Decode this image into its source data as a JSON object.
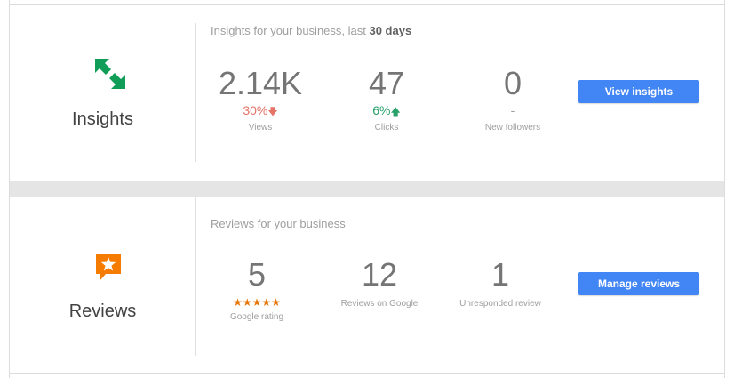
{
  "colors": {
    "accent": "#4285f4",
    "insights_icon": "#0f9d58",
    "reviews_icon": "#f57c00",
    "down": "#e57368",
    "up": "#27a06a"
  },
  "insights": {
    "icon": "arrows-exchange-icon",
    "label": "Insights",
    "caption_prefix": "Insights for your business, last ",
    "caption_bold": "30 days",
    "metrics": [
      {
        "value": "2.14K",
        "delta": "30%",
        "direction": "down",
        "arrow": "down-arrow-icon",
        "label": "Views"
      },
      {
        "value": "47",
        "delta": "6%",
        "direction": "up",
        "arrow": "up-arrow-icon",
        "label": "Clicks"
      },
      {
        "value": "0",
        "delta": "-",
        "direction": "none",
        "label": "New followers"
      }
    ],
    "button": "View insights"
  },
  "reviews": {
    "icon": "star-speech-bubble-icon",
    "label": "Reviews",
    "caption": "Reviews for your business",
    "metrics": [
      {
        "value": "5",
        "stars": "★★★★★",
        "rating": 5,
        "label": "Google rating"
      },
      {
        "value": "12",
        "label": "Reviews on Google"
      },
      {
        "value": "1",
        "label": "Unresponded review"
      }
    ],
    "button": "Manage reviews"
  }
}
